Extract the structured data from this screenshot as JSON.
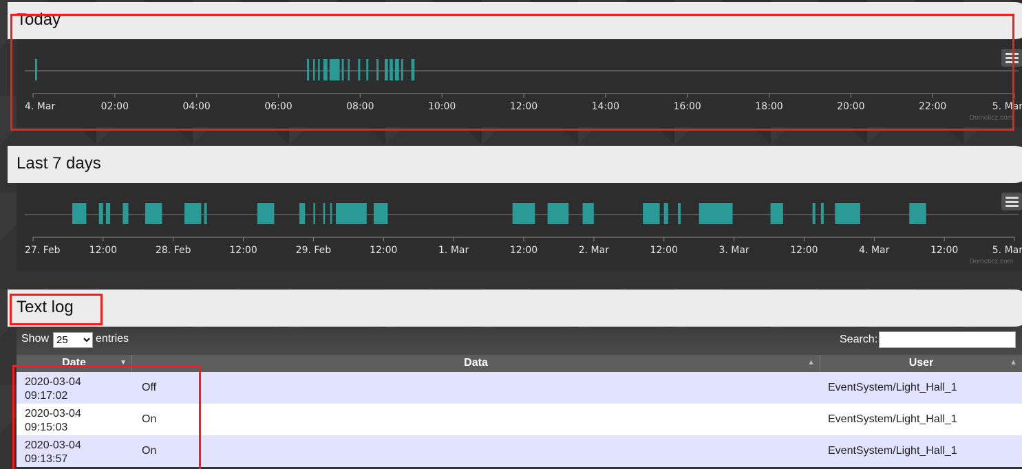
{
  "sections": {
    "today_title": "Today",
    "week_title": "Last 7 days",
    "log_title": "Text log"
  },
  "charts": {
    "credit": "Domoticz.com",
    "today_ticks": [
      "4. Mar",
      "02:00",
      "04:00",
      "06:00",
      "08:00",
      "10:00",
      "12:00",
      "14:00",
      "16:00",
      "18:00",
      "20:00",
      "22:00",
      "5. Mar"
    ],
    "week_ticks": [
      "27. Feb",
      "12:00",
      "28. Feb",
      "12:00",
      "29. Feb",
      "12:00",
      "1. Mar",
      "12:00",
      "2. Mar",
      "12:00",
      "3. Mar",
      "12:00",
      "4. Mar",
      "12:00",
      "5. Mar"
    ],
    "accent_color": "#2a9a96",
    "menu_icon": "hamburger-menu-icon"
  },
  "chart_data": [
    {
      "type": "timeline",
      "title": "Today",
      "x_range": [
        "4. Mar 00:00",
        "5. Mar 00:00"
      ],
      "on_intervals_hours": [
        [
          0.05,
          0.1
        ],
        [
          6.7,
          6.75
        ],
        [
          6.85,
          6.88
        ],
        [
          6.97,
          7.0
        ],
        [
          7.1,
          7.2
        ],
        [
          7.25,
          7.5
        ],
        [
          7.55,
          7.6
        ],
        [
          7.7,
          7.72
        ],
        [
          7.95,
          8.0
        ],
        [
          8.15,
          8.2
        ],
        [
          8.4,
          8.45
        ],
        [
          8.6,
          8.68
        ],
        [
          8.72,
          8.8
        ],
        [
          8.85,
          8.95
        ],
        [
          9.0,
          9.05
        ],
        [
          9.25,
          9.33
        ]
      ]
    },
    {
      "type": "timeline",
      "title": "Last 7 days",
      "x_range": [
        "27. Feb 00:00",
        "5. Mar 00:00"
      ],
      "on_intervals_days": [
        [
          0.28,
          0.38
        ],
        [
          0.47,
          0.5
        ],
        [
          0.52,
          0.55
        ],
        [
          0.64,
          0.68
        ],
        [
          0.8,
          0.92
        ],
        [
          1.08,
          1.2
        ],
        [
          1.22,
          1.24
        ],
        [
          1.6,
          1.72
        ],
        [
          1.9,
          1.94
        ],
        [
          2.0,
          2.01
        ],
        [
          2.07,
          2.08
        ],
        [
          2.12,
          2.12
        ],
        [
          2.16,
          2.38
        ],
        [
          2.43,
          2.53
        ],
        [
          3.42,
          3.58
        ],
        [
          3.67,
          3.82
        ],
        [
          3.92,
          4.0
        ],
        [
          4.35,
          4.47
        ],
        [
          4.5,
          4.53
        ],
        [
          4.6,
          4.62
        ],
        [
          4.75,
          4.99
        ],
        [
          5.26,
          5.35
        ],
        [
          5.56,
          5.58
        ],
        [
          5.62,
          5.64
        ],
        [
          5.72,
          5.9
        ],
        [
          6.25,
          6.37
        ]
      ]
    }
  ],
  "table": {
    "show_label": "Show",
    "page_size": "25",
    "entries_label": "entries",
    "search_label": "Search:",
    "search_value": "",
    "columns": [
      "Date",
      "Data",
      "User"
    ],
    "rows": [
      {
        "date": "2020-03-04 09:17:02",
        "data": "Off",
        "user": "EventSystem/Light_Hall_1"
      },
      {
        "date": "2020-03-04 09:15:03",
        "data": "On",
        "user": "EventSystem/Light_Hall_1"
      },
      {
        "date": "2020-03-04 09:13:57",
        "data": "On",
        "user": "EventSystem/Light_Hall_1"
      }
    ]
  }
}
